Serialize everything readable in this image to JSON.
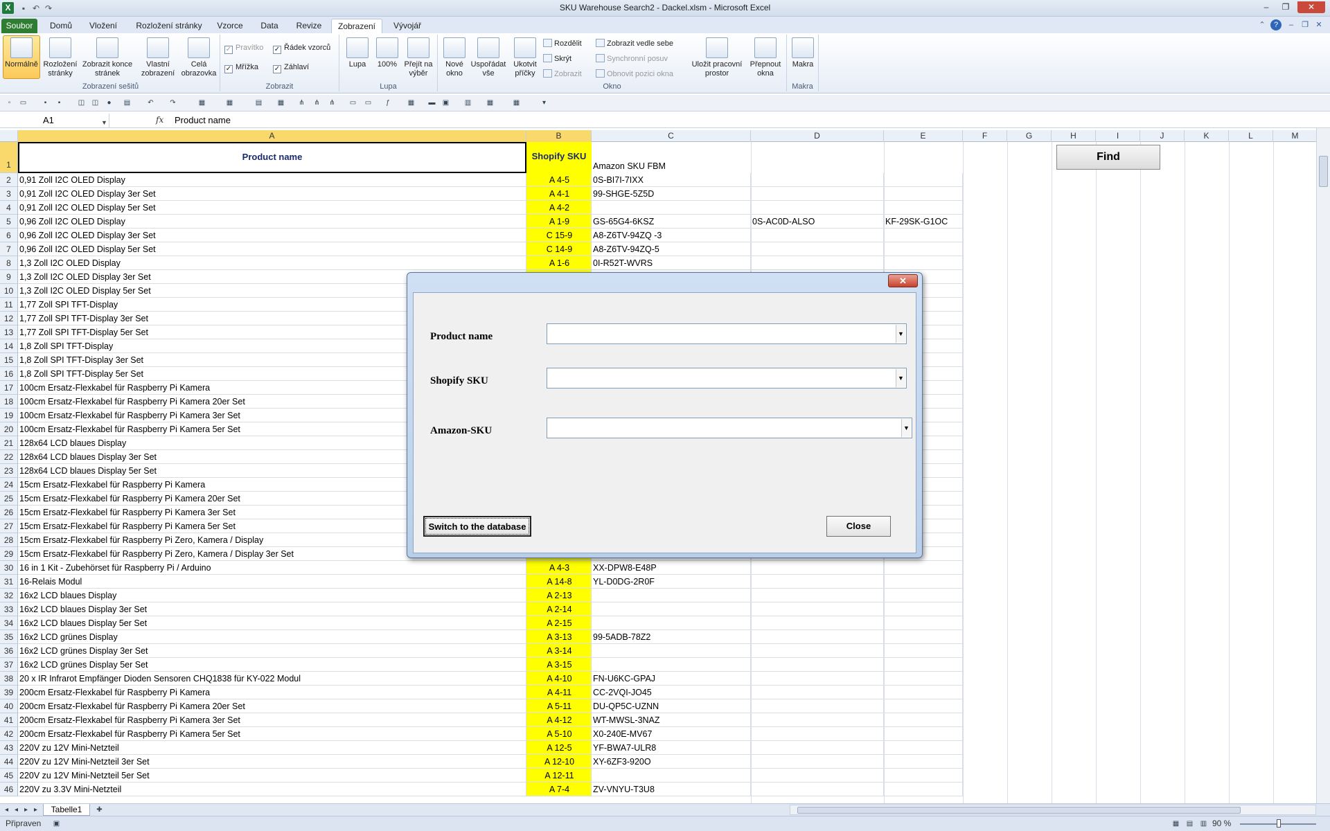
{
  "app": {
    "title": "SKU Warehouse Search2 - Dackel.xlsm - Microsoft Excel",
    "icon": "excel-icon"
  },
  "tabs": [
    "Soubor",
    "Domů",
    "Vložení",
    "Rozložení stránky",
    "Vzorce",
    "Data",
    "Revize",
    "Zobrazení",
    "Vývojář"
  ],
  "ribbon": {
    "workbook_views": {
      "label": "Zobrazení sešitů",
      "normal": "Normálně",
      "page_layout": "Rozložení stránky",
      "page_break": "Zobrazit konce stránek",
      "custom": "Vlastní zobrazení",
      "full": "Celá obrazovka"
    },
    "show": {
      "label": "Zobrazit",
      "ruler": "Pravítko",
      "formula_bar": "Řádek vzorců",
      "gridlines": "Mřížka",
      "headings": "Záhlaví"
    },
    "zoom": {
      "label": "Lupa",
      "zoom": "Lupa",
      "percent": "100%",
      "to_selection": "Přejít na výběr"
    },
    "window": {
      "label": "Okno",
      "new": "Nové okno",
      "arrange": "Uspořádat vše",
      "freeze": "Ukotvit příčky",
      "split": "Rozdělit",
      "hide": "Skrýt",
      "unhide": "Zobrazit",
      "side_by_side": "Zobrazit vedle sebe",
      "sync_scroll": "Synchronní posuv",
      "reset_pos": "Obnovit pozici okna",
      "save_ws": "Uložit pracovní prostor",
      "switch": "Přepnout okna"
    },
    "macros": {
      "label": "Makra",
      "macros": "Makra"
    }
  },
  "formula": {
    "namebox": "A1",
    "fx": "fx",
    "value": "Product name"
  },
  "columns": [
    "A",
    "B",
    "C",
    "D",
    "E",
    "F",
    "G",
    "H",
    "I",
    "J",
    "K",
    "L",
    "M"
  ],
  "header_row": {
    "a": "Product name",
    "b": "Shopify SKU",
    "c": "Amazon SKU FBM"
  },
  "find_button": "Find",
  "rows": [
    {
      "n": "2",
      "a": "0,91 Zoll I2C OLED Display",
      "b": "A 4-5",
      "c": "0S-BI7I-7IXX",
      "d": "",
      "e": ""
    },
    {
      "n": "3",
      "a": "0,91 Zoll I2C OLED Display 3er Set",
      "b": "A 4-1",
      "c": "99-SHGE-5Z5D",
      "d": "",
      "e": ""
    },
    {
      "n": "4",
      "a": "0,91 Zoll I2C OLED Display 5er Set",
      "b": "A 4-2",
      "c": "",
      "d": "",
      "e": ""
    },
    {
      "n": "5",
      "a": "0,96 Zoll I2C OLED Display",
      "b": "A 1-9",
      "c": "GS-65G4-6KSZ",
      "d": "0S-AC0D-ALSO",
      "e": "KF-29SK-G1OC"
    },
    {
      "n": "6",
      "a": "0,96 Zoll I2C OLED Display 3er Set",
      "b": "C 15-9",
      "c": "A8-Z6TV-94ZQ -3",
      "d": "",
      "e": ""
    },
    {
      "n": "7",
      "a": "0,96 Zoll I2C OLED Display 5er Set",
      "b": "C 14-9",
      "c": "A8-Z6TV-94ZQ-5",
      "d": "",
      "e": ""
    },
    {
      "n": "8",
      "a": "1,3 Zoll I2C OLED Display",
      "b": "A 1-6",
      "c": "0I-R52T-WVRS",
      "d": "",
      "e": ""
    },
    {
      "n": "9",
      "a": "1,3 Zoll I2C OLED Display 3er Set",
      "b": "",
      "c": "",
      "d": "",
      "e": ""
    },
    {
      "n": "10",
      "a": "1,3 Zoll I2C OLED Display 5er Set",
      "b": "",
      "c": "",
      "d": "",
      "e": ""
    },
    {
      "n": "11",
      "a": "1,77 Zoll SPI TFT-Display",
      "b": "",
      "c": "",
      "d": "",
      "e": ""
    },
    {
      "n": "12",
      "a": "1,77 Zoll SPI TFT-Display 3er Set",
      "b": "",
      "c": "",
      "d": "",
      "e": ""
    },
    {
      "n": "13",
      "a": "1,77 Zoll SPI TFT-Display 5er Set",
      "b": "",
      "c": "",
      "d": "",
      "e": ""
    },
    {
      "n": "14",
      "a": "1,8 Zoll SPI TFT-Display",
      "b": "",
      "c": "",
      "d": "",
      "e": ""
    },
    {
      "n": "15",
      "a": "1,8 Zoll SPI TFT-Display 3er Set",
      "b": "",
      "c": "",
      "d": "",
      "e": ""
    },
    {
      "n": "16",
      "a": "1,8 Zoll SPI TFT-Display 5er Set",
      "b": "",
      "c": "",
      "d": "",
      "e": ""
    },
    {
      "n": "17",
      "a": "100cm Ersatz-Flexkabel für Raspberry Pi Kamera",
      "b": "",
      "c": "",
      "d": "",
      "e": ""
    },
    {
      "n": "18",
      "a": "100cm Ersatz-Flexkabel für Raspberry Pi Kamera 20er Set",
      "b": "",
      "c": "",
      "d": "",
      "e": ""
    },
    {
      "n": "19",
      "a": "100cm Ersatz-Flexkabel für Raspberry Pi Kamera 3er Set",
      "b": "",
      "c": "",
      "d": "",
      "e": ""
    },
    {
      "n": "20",
      "a": "100cm Ersatz-Flexkabel für Raspberry Pi Kamera 5er Set",
      "b": "",
      "c": "",
      "d": "",
      "e": ""
    },
    {
      "n": "21",
      "a": "128x64 LCD blaues Display",
      "b": "",
      "c": "",
      "d": "",
      "e": ""
    },
    {
      "n": "22",
      "a": "128x64 LCD blaues Display 3er Set",
      "b": "",
      "c": "",
      "d": "",
      "e": ""
    },
    {
      "n": "23",
      "a": "128x64 LCD blaues Display 5er Set",
      "b": "",
      "c": "",
      "d": "",
      "e": ""
    },
    {
      "n": "24",
      "a": "15cm Ersatz-Flexkabel für Raspberry Pi Kamera",
      "b": "",
      "c": "",
      "d": "",
      "e": ""
    },
    {
      "n": "25",
      "a": "15cm Ersatz-Flexkabel für Raspberry Pi Kamera 20er Set",
      "b": "",
      "c": "",
      "d": "",
      "e": ""
    },
    {
      "n": "26",
      "a": "15cm Ersatz-Flexkabel für Raspberry Pi Kamera 3er Set",
      "b": "",
      "c": "",
      "d": "",
      "e": ""
    },
    {
      "n": "27",
      "a": "15cm Ersatz-Flexkabel für Raspberry Pi Kamera 5er Set",
      "b": "",
      "c": "",
      "d": "",
      "e": ""
    },
    {
      "n": "28",
      "a": "15cm Ersatz-Flexkabel für Raspberry Pi Zero, Kamera / Display",
      "b": "",
      "c": "",
      "d": "",
      "e": ""
    },
    {
      "n": "29",
      "a": "15cm Ersatz-Flexkabel für Raspberry Pi Zero, Kamera / Display 3er Set",
      "b": "",
      "c": "",
      "d": "",
      "e": ""
    },
    {
      "n": "30",
      "a": "16 in 1 Kit - Zubehörset für Raspberry Pi / Arduino",
      "b": "A 4-3",
      "c": "XX-DPW8-E48P",
      "d": "",
      "e": ""
    },
    {
      "n": "31",
      "a": "16-Relais Modul",
      "b": "A 14-8",
      "c": "YL-D0DG-2R0F",
      "d": "",
      "e": ""
    },
    {
      "n": "32",
      "a": "16x2 LCD blaues Display",
      "b": "A 2-13",
      "c": "",
      "d": "",
      "e": ""
    },
    {
      "n": "33",
      "a": "16x2 LCD blaues Display 3er Set",
      "b": "A 2-14",
      "c": "",
      "d": "",
      "e": ""
    },
    {
      "n": "34",
      "a": "16x2 LCD blaues Display 5er Set",
      "b": "A 2-15",
      "c": "",
      "d": "",
      "e": ""
    },
    {
      "n": "35",
      "a": "16x2 LCD grünes Display",
      "b": "A 3-13",
      "c": "99-5ADB-78Z2",
      "d": "",
      "e": ""
    },
    {
      "n": "36",
      "a": "16x2 LCD grünes Display 3er Set",
      "b": "A 3-14",
      "c": "",
      "d": "",
      "e": ""
    },
    {
      "n": "37",
      "a": "16x2 LCD grünes Display 5er Set",
      "b": "A 3-15",
      "c": "",
      "d": "",
      "e": ""
    },
    {
      "n": "38",
      "a": "20 x IR Infrarot Empfänger Dioden Sensoren CHQ1838 für KY-022 Modul",
      "b": "A 4-10",
      "c": "FN-U6KC-GPAJ",
      "d": "",
      "e": ""
    },
    {
      "n": "39",
      "a": "200cm Ersatz-Flexkabel für Raspberry Pi Kamera",
      "b": "A 4-11",
      "c": "CC-2VQI-JO45",
      "d": "",
      "e": ""
    },
    {
      "n": "40",
      "a": "200cm Ersatz-Flexkabel für Raspberry Pi Kamera 20er Set",
      "b": "A 5-11",
      "c": "DU-QP5C-UZNN",
      "d": "",
      "e": ""
    },
    {
      "n": "41",
      "a": "200cm Ersatz-Flexkabel für Raspberry Pi Kamera 3er Set",
      "b": "A 4-12",
      "c": "WT-MWSL-3NAZ",
      "d": "",
      "e": ""
    },
    {
      "n": "42",
      "a": "200cm Ersatz-Flexkabel für Raspberry Pi Kamera 5er Set",
      "b": "A 5-10",
      "c": "X0-240E-MV67",
      "d": "",
      "e": ""
    },
    {
      "n": "43",
      "a": "220V zu 12V Mini-Netzteil",
      "b": "A 12-5",
      "c": "YF-BWA7-ULR8",
      "d": "",
      "e": ""
    },
    {
      "n": "44",
      "a": "220V zu 12V Mini-Netzteil 3er Set",
      "b": "A 12-10",
      "c": "XY-6ZF3-920O",
      "d": "",
      "e": ""
    },
    {
      "n": "45",
      "a": "220V zu 12V Mini-Netzteil 5er Set",
      "b": "A 12-11",
      "c": "",
      "d": "",
      "e": ""
    },
    {
      "n": "46",
      "a": "220V zu 3.3V Mini-Netzteil",
      "b": "A 7-4",
      "c": "ZV-VNYU-T3U8",
      "d": "",
      "e": ""
    }
  ],
  "dialog": {
    "close_x": "✕",
    "product_label": "Product name",
    "shopify_label": "Shopify SKU",
    "amazon_label": "Amazon-SKU",
    "product_value": "",
    "shopify_value": "",
    "amazon_value": "",
    "switch_button": "Switch to the database",
    "close_button": "Close"
  },
  "sheet_tab": "Tabelle1",
  "status": {
    "text": "Připraven",
    "zoom": "90 %"
  }
}
